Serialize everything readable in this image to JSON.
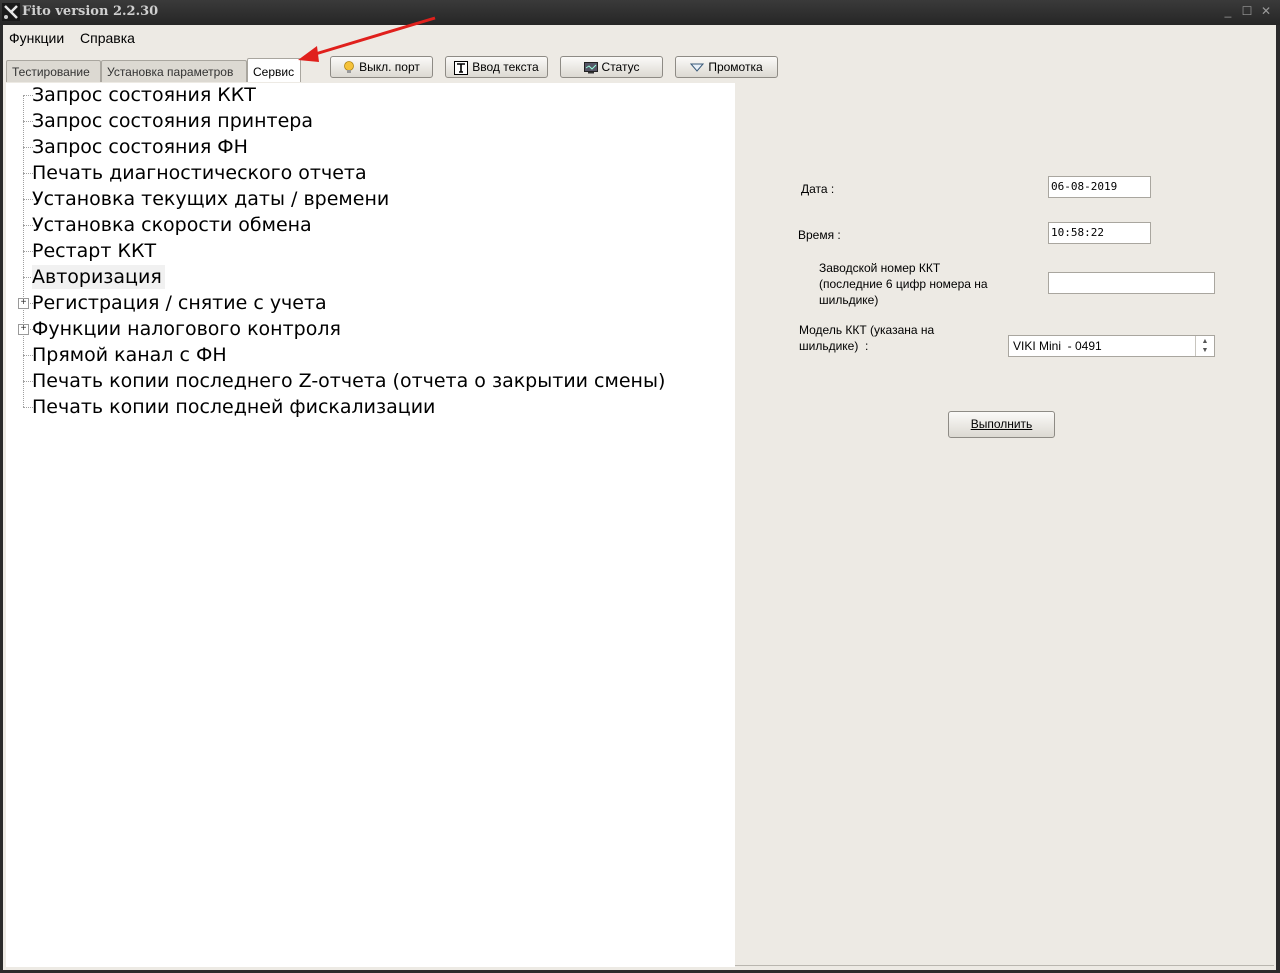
{
  "window": {
    "title": "Fito version 2.2.30",
    "controls": {
      "minimize": "_",
      "maximize": "☐",
      "close": "✕"
    }
  },
  "menu": {
    "items": [
      "Функции",
      "Справка"
    ]
  },
  "tabs": [
    {
      "label": "Тестирование",
      "active": false
    },
    {
      "label": "Установка параметров",
      "active": false
    },
    {
      "label": "Сервис",
      "active": true
    }
  ],
  "toolbar": {
    "buttons": [
      {
        "label": "Выкл. порт",
        "icon": "lightbulb-icon"
      },
      {
        "label": "Ввод текста",
        "icon": "text-icon"
      },
      {
        "label": "Статус",
        "icon": "monitor-icon"
      },
      {
        "label": "Промотка",
        "icon": "chevron-down-icon"
      }
    ]
  },
  "tree": {
    "items": [
      {
        "label": "Запрос состояния ККТ",
        "expandable": false
      },
      {
        "label": "Запрос состояния принтера",
        "expandable": false
      },
      {
        "label": "Запрос состояния ФН",
        "expandable": false
      },
      {
        "label": "Печать диагностического отчета",
        "expandable": false
      },
      {
        "label": "Установка текущих даты / времени",
        "expandable": false
      },
      {
        "label": "Установка скорости обмена",
        "expandable": false
      },
      {
        "label": "Рестарт ККТ",
        "expandable": false
      },
      {
        "label": "Авторизация",
        "expandable": false,
        "selected": true
      },
      {
        "label": "Регистрация / снятие с учета",
        "expandable": true
      },
      {
        "label": "Функции налогового контроля",
        "expandable": true
      },
      {
        "label": "Прямой канал с ФН",
        "expandable": false
      },
      {
        "label": "Печать копии последнего Z-отчета (отчета о закрытии смены)",
        "expandable": false
      },
      {
        "label": "Печать копии последней фискализации",
        "expandable": false
      }
    ]
  },
  "form": {
    "date_label": "Дата :",
    "date_value": "06-08-2019",
    "time_label": "Время :",
    "time_value": "10:58:22",
    "serial_label_1": "Заводской номер ККТ",
    "serial_label_2": "(последние 6 цифр номера на",
    "serial_label_3": "шильдике)",
    "serial_value": "",
    "model_label_1": "Модель ККТ (указана на",
    "model_label_2": "шильдике)  :",
    "model_value": "VIKI Mini  - 0491",
    "execute_label": "Выполнить"
  },
  "colors": {
    "annotation_arrow": "#e0201c",
    "panel_bg": "#edeae4",
    "titlebar_bg": "#2b2b2b"
  }
}
